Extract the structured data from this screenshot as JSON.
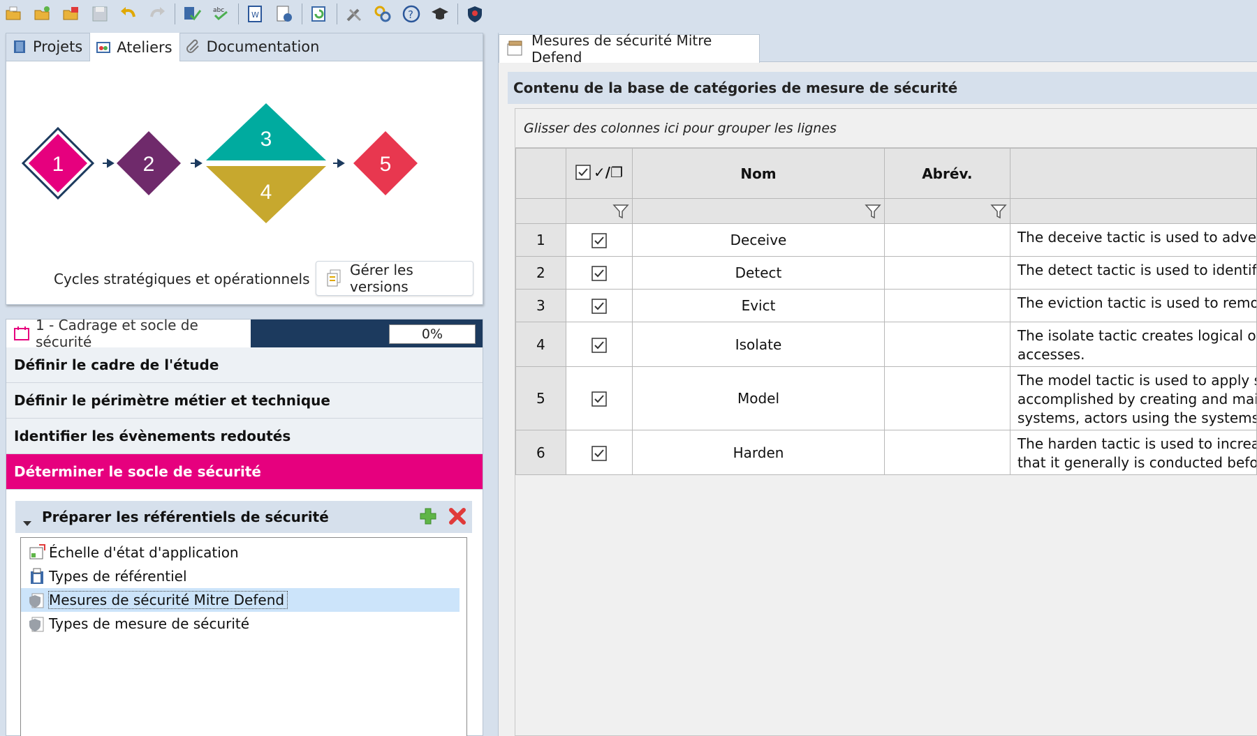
{
  "toolbar": {
    "icons": [
      "open-folder-icon",
      "new-folder-icon",
      "open-project-icon",
      "save-icon",
      "undo-icon",
      "redo-icon",
      "validate-icon",
      "spellcheck-icon",
      "export-word-icon",
      "report-icon",
      "refresh-icon",
      "tools-icon",
      "transfer-icon",
      "help-icon",
      "training-icon",
      "shield-icon"
    ]
  },
  "left_top": {
    "tabs": [
      {
        "label": "Projets",
        "icon": "book-icon"
      },
      {
        "label": "Ateliers",
        "icon": "workshop-icon"
      },
      {
        "label": "Documentation",
        "icon": "paperclip-icon"
      }
    ],
    "workshops": [
      {
        "label": "1",
        "color": "#e6007e"
      },
      {
        "label": "2",
        "color": "#6f2a6b"
      },
      {
        "label": "3",
        "color": "#00ab9f"
      },
      {
        "label": "4",
        "color": "#c7a82e"
      },
      {
        "label": "5",
        "color": "#e8374f"
      }
    ],
    "cycles_label": "Cycles stratégiques et opérationnels :",
    "versions_button": "Gérer les versions"
  },
  "left_bottom": {
    "tab_label": "1 - Cadrage et socle de sécurité",
    "progress": "0%",
    "steps": [
      {
        "label": "Définir le cadre de l'étude",
        "active": false
      },
      {
        "label": "Définir le périmètre métier et technique",
        "active": false
      },
      {
        "label": "Identifier les évènements redoutés",
        "active": false
      },
      {
        "label": "Déterminer le socle de sécurité",
        "active": true
      }
    ],
    "subsection": "Préparer les référentiels de sécurité",
    "references": [
      {
        "label": "Échelle d'état d'application",
        "icon": "scale-icon"
      },
      {
        "label": "Types de référentiel",
        "icon": "document-stack-icon"
      },
      {
        "label": "Mesures de sécurité Mitre Defend",
        "icon": "shield-doc-icon",
        "selected": true
      },
      {
        "label": "Types de mesure de sécurité",
        "icon": "shield-doc-icon"
      }
    ]
  },
  "right": {
    "tab_label": "Mesures de sécurité Mitre Defend",
    "title": "Contenu de la base de catégories de mesure de sécurité",
    "group_hint": "Glisser des colonnes ici pour grouper les lignes",
    "columns": {
      "check": "✓/❐",
      "name": "Nom",
      "abrev": "Abrév.",
      "desc": ""
    },
    "rows": [
      {
        "num": "1",
        "name": "Deceive",
        "abrev": "",
        "desc": [
          "The deceive tactic is used to advertis"
        ]
      },
      {
        "num": "2",
        "name": "Detect",
        "abrev": "",
        "desc": [
          "The detect tactic is used to identify a"
        ]
      },
      {
        "num": "3",
        "name": "Evict",
        "abrev": "",
        "desc": [
          "The eviction tactic is used to remove"
        ]
      },
      {
        "num": "4",
        "name": "Isolate",
        "abrev": "",
        "desc": [
          "The isolate tactic creates logical or p",
          "accesses."
        ]
      },
      {
        "num": "5",
        "name": "Model",
        "abrev": "",
        "desc": [
          "The model tactic is used to apply se",
          "accomplished by creating and main",
          "systems, actors using the systems, a"
        ]
      },
      {
        "num": "6",
        "name": "Harden",
        "abrev": "",
        "desc": [
          "The harden tactic is used to increase",
          "that it generally is conducted before"
        ]
      }
    ]
  }
}
